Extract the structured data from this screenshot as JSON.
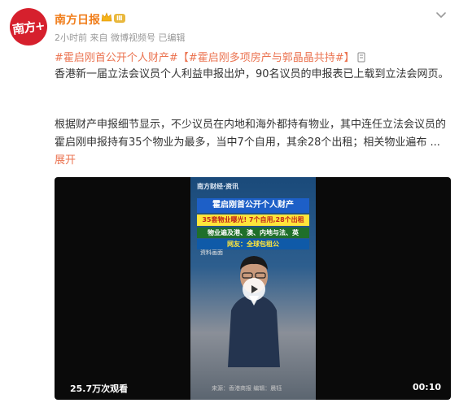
{
  "post": {
    "author": {
      "name": "南方日报",
      "avatar_text": "南方+",
      "level_badge": "Ⅲ"
    },
    "meta": "2小时前 来自 微博视频号 已编辑",
    "hashtag1": "#霍启刚首公开个人财产#",
    "hashtag2": "【#霍启刚多项房产与郭晶晶共持#】",
    "paragraph1": "香港新一届立法会议员个人利益申报出炉，90名议员的申报表已上载到立法会网页。",
    "paragraph2": "根据财产申报细节显示，不少议员在内地和海外都持有物业，其中连任立法会议员的霍启刚申报持有35个物业为最多，当中7个自用，其余28个出租；相关物业遍布",
    "ellipsis": "...",
    "expand": "展开"
  },
  "video": {
    "views": "25.7万次观看",
    "duration": "00:10",
    "frame": {
      "logo": "南方财经·资讯",
      "title": "霍启刚首公开个人财产",
      "sub": "35套物业曝光! 7个自用,28个出租",
      "line1": "物业遍及港、澳、内地与法、英",
      "line2": "网友：全球包租公",
      "caption": "资料画面",
      "footer": "来源：香港商报 编辑：晨钰"
    }
  },
  "colors": {
    "brand_orange": "#f07d1a",
    "link": "#eb7350",
    "avatar_red": "#d6202d"
  }
}
